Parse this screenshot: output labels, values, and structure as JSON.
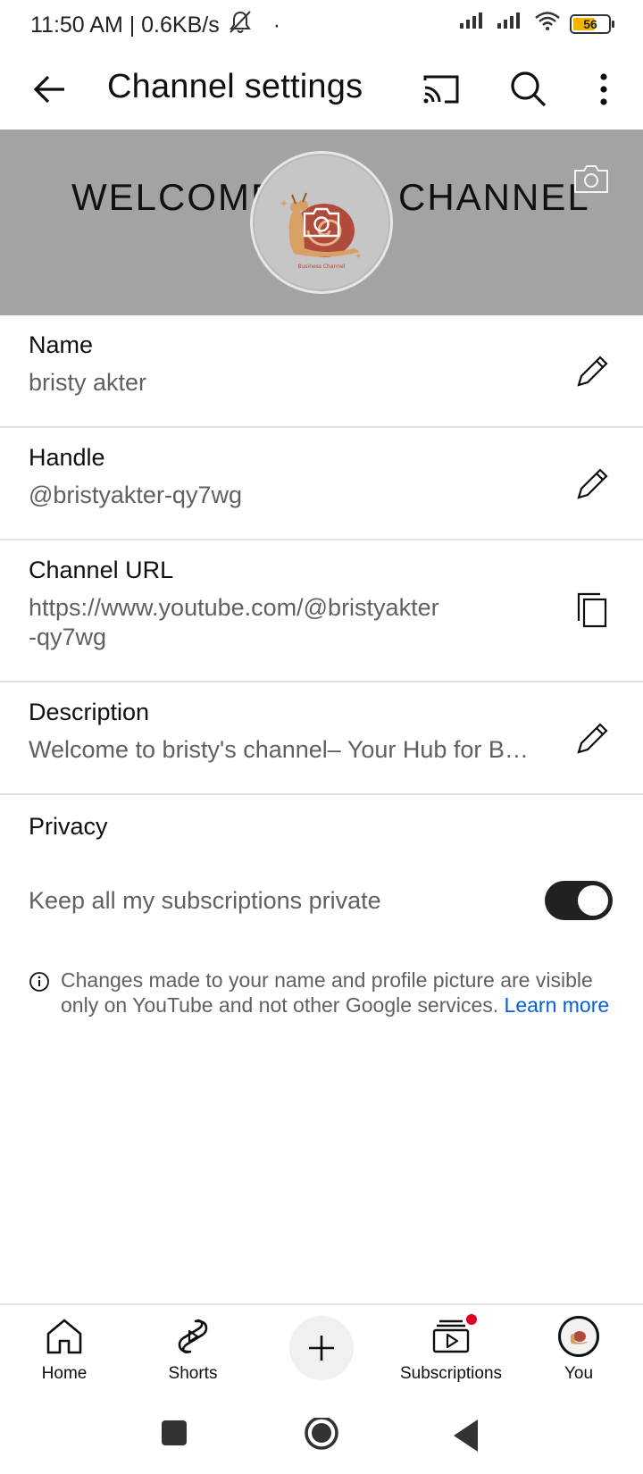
{
  "status_bar": {
    "time_speed": "11:50 AM | 0.6KB/s",
    "dot": "·",
    "battery": "56",
    "icons": [
      "mute-bell-icon",
      "signal-icon",
      "signal-icon",
      "wifi-icon",
      "battery-icon"
    ]
  },
  "app_bar": {
    "title": "Channel settings",
    "icons": [
      "back-arrow-icon",
      "cast-icon",
      "search-icon",
      "more-vert-icon"
    ]
  },
  "banner": {
    "text_left": "WELCOME",
    "text_right": "CHANNEL",
    "avatar_caption": "Business Channel"
  },
  "settings": {
    "name": {
      "label": "Name",
      "value": "bristy akter"
    },
    "handle": {
      "label": "Handle",
      "value": "@bristyakter-qy7wg"
    },
    "url": {
      "label": "Channel URL",
      "value_line1": "https://www.youtube.com/@bristyakter",
      "value_line2": "-qy7wg"
    },
    "description": {
      "label": "Description",
      "value": "Welcome to bristy's channel– Your Hub for B…"
    }
  },
  "privacy": {
    "title": "Privacy",
    "toggle_label": "Keep all my subscriptions private",
    "toggle_on": true
  },
  "info": {
    "text": "Changes made to your name and profile picture are visible only on YouTube and not other Google services.",
    "link": "Learn more"
  },
  "bottom_nav": {
    "home": "Home",
    "shorts": "Shorts",
    "subscriptions": "Subscriptions",
    "you": "You"
  },
  "colors": {
    "banner_bg": "#a3a3a3",
    "link": "#065fd4",
    "notif_dot": "#e00021",
    "toggle_bg": "#212121"
  }
}
